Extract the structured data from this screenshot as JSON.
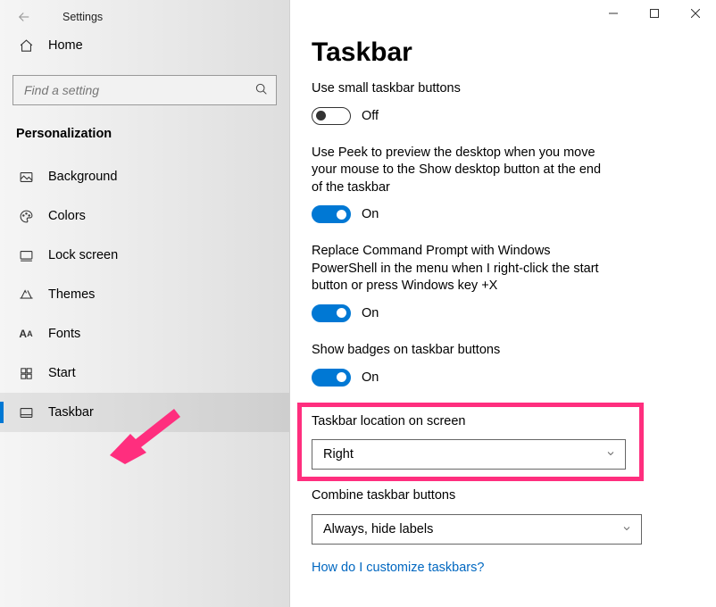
{
  "app": {
    "title": "Settings",
    "section": "Personalization",
    "search_placeholder": "Find a setting",
    "home_label": "Home",
    "nav": [
      {
        "label": "Background",
        "icon": "image"
      },
      {
        "label": "Colors",
        "icon": "palette"
      },
      {
        "label": "Lock screen",
        "icon": "lockscreen"
      },
      {
        "label": "Themes",
        "icon": "themes"
      },
      {
        "label": "Fonts",
        "icon": "fonts"
      },
      {
        "label": "Start",
        "icon": "start"
      },
      {
        "label": "Taskbar",
        "icon": "taskbar"
      }
    ],
    "selected_nav": "Taskbar"
  },
  "page": {
    "title": "Taskbar",
    "settings": [
      {
        "label": "Use small taskbar buttons",
        "type": "toggle",
        "value": "Off",
        "on": false
      },
      {
        "label": "Use Peek to preview the desktop when you move your mouse to the Show desktop button at the end of the taskbar",
        "type": "toggle",
        "value": "On",
        "on": true
      },
      {
        "label": "Replace Command Prompt with Windows PowerShell in the menu when I right-click the start button or press Windows key +X",
        "type": "toggle",
        "value": "On",
        "on": true
      },
      {
        "label": "Show badges on taskbar buttons",
        "type": "toggle",
        "value": "On",
        "on": true
      },
      {
        "label": "Taskbar location on screen",
        "type": "dropdown",
        "value": "Right"
      },
      {
        "label": "Combine taskbar buttons",
        "type": "dropdown",
        "value": "Always, hide labels"
      }
    ],
    "help_link": "How do I customize taskbars?"
  },
  "annotations": {
    "highlight_target": "Taskbar location on screen",
    "arrow_target": "Taskbar"
  }
}
